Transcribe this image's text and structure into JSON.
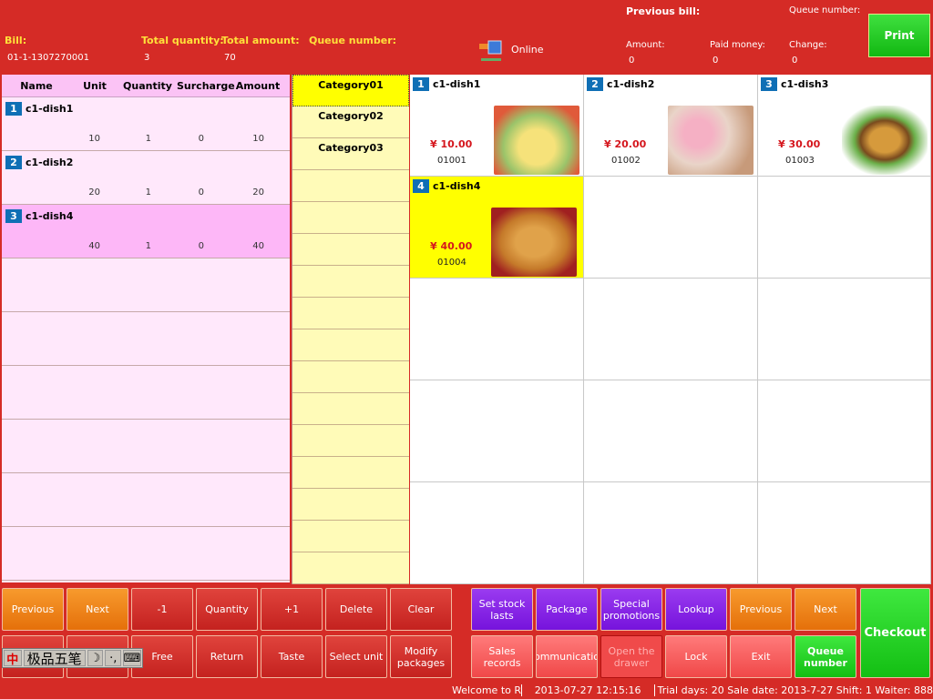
{
  "header": {
    "bill_label": "Bill:",
    "bill_value": "01-1-1307270001",
    "total_quantity_label": "Total quantity:",
    "total_quantity_value": "3",
    "total_amount_label": "Total amount:",
    "total_amount_value": "70",
    "queue_number_label": "Queue number:",
    "online_label": "Online",
    "previous_bill_label": "Previous bill:",
    "prev_queue_number_label": "Queue number:",
    "amount_label": "Amount:",
    "amount_value": "0",
    "paid_label": "Paid money:",
    "paid_value": "0",
    "change_label": "Change:",
    "change_value": "0",
    "print_label": "Print"
  },
  "order": {
    "columns": [
      "Name",
      "Unit",
      "Quantity",
      "Surcharge",
      "Amount"
    ],
    "rows": [
      {
        "no": "1",
        "name": "c1-dish1",
        "unit": "10",
        "quantity": "1",
        "surcharge": "0",
        "amount": "10"
      },
      {
        "no": "2",
        "name": "c1-dish2",
        "unit": "20",
        "quantity": "1",
        "surcharge": "0",
        "amount": "20"
      },
      {
        "no": "3",
        "name": "c1-dish4",
        "unit": "40",
        "quantity": "1",
        "surcharge": "0",
        "amount": "40",
        "selected": true
      }
    ]
  },
  "categories": [
    "Category01",
    "Category02",
    "Category03"
  ],
  "dishes": [
    {
      "no": "1",
      "name": "c1-dish1",
      "price": "¥ 10.00",
      "code": "01001",
      "image": "cake"
    },
    {
      "no": "2",
      "name": "c1-dish2",
      "price": "¥ 20.00",
      "code": "01002",
      "image": "cupcakes"
    },
    {
      "no": "3",
      "name": "c1-dish3",
      "price": "¥ 30.00",
      "code": "01003",
      "image": "burger"
    },
    {
      "no": "4",
      "name": "c1-dish4",
      "price": "¥ 40.00",
      "code": "01004",
      "image": "pizza",
      "selected": true
    }
  ],
  "buttons": {
    "previous": "Previous",
    "next": "Next",
    "minus_one": "-1",
    "quantity": "Quantity",
    "plus_one": "+1",
    "delete": "Delete",
    "clear": "Clear",
    "free": "Free",
    "return": "Return",
    "taste": "Taste",
    "select_unit": "Select unit",
    "modify_packages": "Modify packages",
    "set_stock_lasts": "Set stock lasts",
    "package": "Package",
    "special_promotions": "Special promotions",
    "lookup": "Lookup",
    "previous2": "Previous",
    "next2": "Next",
    "checkout": "Checkout",
    "sales_records": "Sales records",
    "communication": "ommunicatio",
    "open_drawer": "Open the drawer",
    "lock": "Lock",
    "exit": "Exit",
    "queue_number": "Queue number"
  },
  "ime": {
    "logo": "中",
    "name": "极品五笔",
    "moon": "☽",
    "punct": "·,",
    "keyboard": "⌨"
  },
  "status": {
    "welcome": "Welcome to  Rest",
    "datetime": "2013-07-27 12:15:16",
    "info": "Trial days: 20 Sale date: 2013-7-27 Shift: 1 Waiter: 888"
  },
  "colors": {
    "background": "#d52b26",
    "selected": "#ffff00",
    "number_badge": "#0f6fb5",
    "price": "#d5161d"
  }
}
